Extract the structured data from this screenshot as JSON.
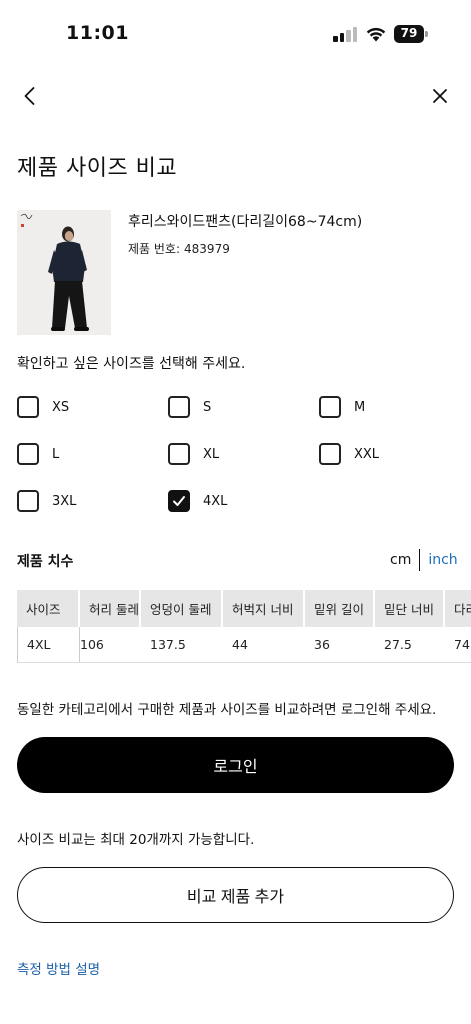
{
  "status_bar": {
    "time": "11:01",
    "battery": "79"
  },
  "header": {
    "title": "제품 사이즈 비교"
  },
  "product": {
    "name": "후리스와이드팬츠(다리길이68~74cm)",
    "number_label": "제품 번호:",
    "number": "483979"
  },
  "size_selection": {
    "prompt": "확인하고 싶은 사이즈를 선택해 주세요.",
    "options": [
      {
        "label": "XS",
        "checked": false
      },
      {
        "label": "S",
        "checked": false
      },
      {
        "label": "M",
        "checked": false
      },
      {
        "label": "L",
        "checked": false
      },
      {
        "label": "XL",
        "checked": false
      },
      {
        "label": "XXL",
        "checked": false
      },
      {
        "label": "3XL",
        "checked": false
      },
      {
        "label": "4XL",
        "checked": true
      }
    ]
  },
  "measurements": {
    "title": "제품 치수",
    "unit_cm": "cm",
    "unit_inch": "inch",
    "columns": [
      "사이즈",
      "허리 둘레",
      "엉덩이 둘레",
      "허벅지 너비",
      "밑위 길이",
      "밑단 너비",
      "다리"
    ],
    "rows": [
      [
        "4XL",
        "106",
        "137.5",
        "44",
        "36",
        "27.5",
        "74"
      ]
    ]
  },
  "login": {
    "prompt": "동일한 카테고리에서 구매한 제품과 사이즈를 비교하려면 로그인해 주세요.",
    "button": "로그인"
  },
  "compare": {
    "note": "사이즈 비교는 최대 20개까지 가능합니다.",
    "button": "비교 제품 추가"
  },
  "help_link": "측정 방법 설명"
}
